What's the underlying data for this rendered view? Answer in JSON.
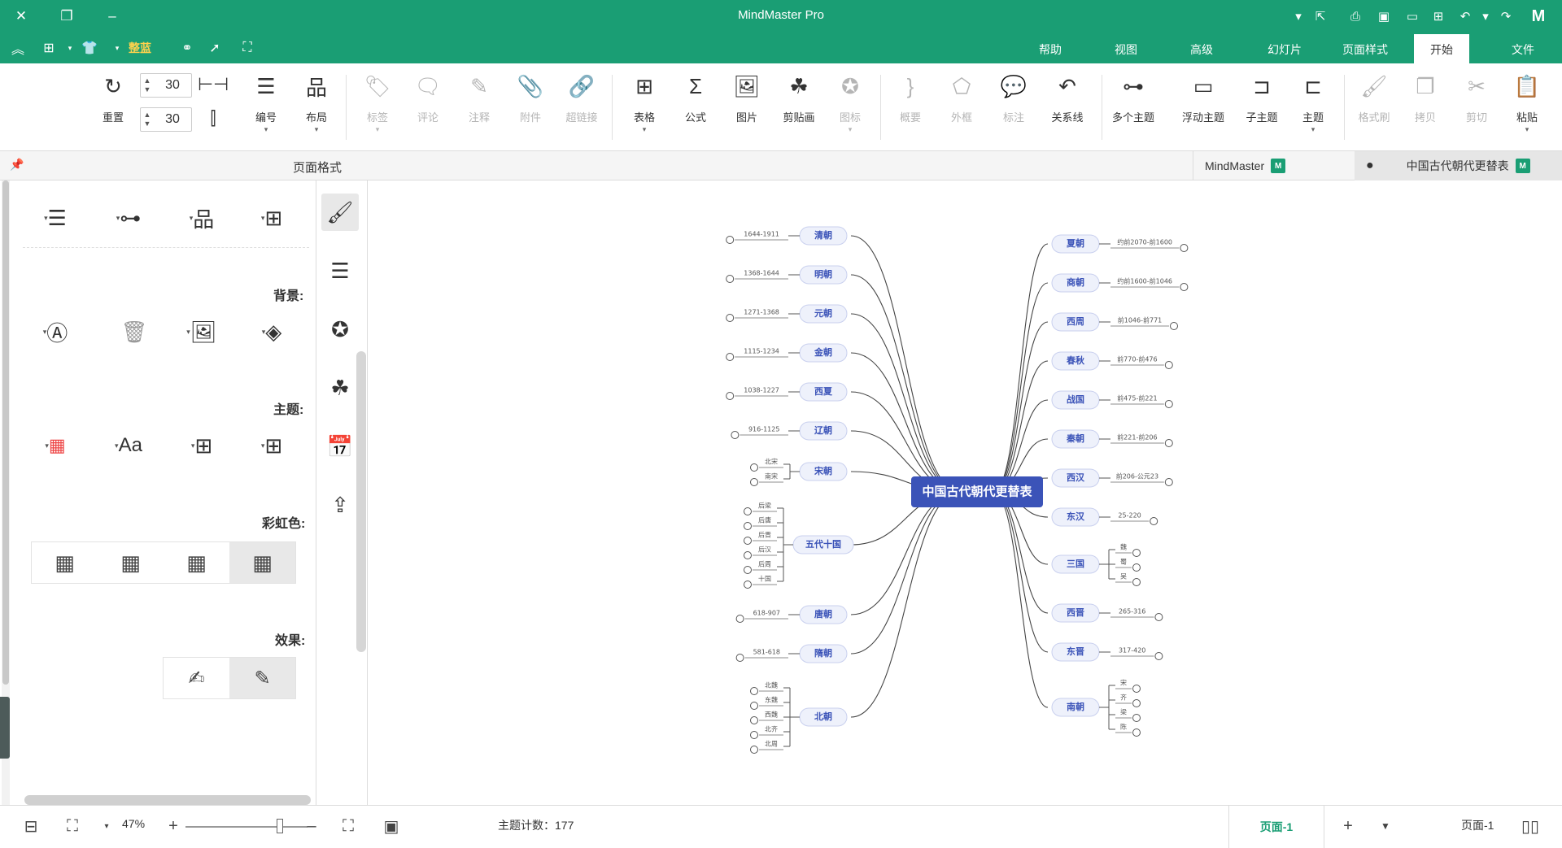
{
  "app": {
    "title": "MindMaster Pro"
  },
  "titlebar_icons": [
    "logo-icon",
    "redo-icon",
    "undo-icon",
    "new-icon",
    "open-icon",
    "save-icon",
    "print-icon",
    "export-icon",
    "more-icon"
  ],
  "menu": {
    "tabs": [
      "文件",
      "开始",
      "页面样式",
      "幻灯片",
      "高级",
      "视图",
      "帮助"
    ],
    "active": "开始",
    "theme_label": "整蓝"
  },
  "ribbon": {
    "buttons": [
      {
        "id": "paste",
        "label": "粘贴",
        "icon": "clipboard-icon",
        "enabled": true,
        "dropdown": true
      },
      {
        "id": "cut",
        "label": "剪切",
        "icon": "scissors-icon",
        "enabled": false
      },
      {
        "id": "copy",
        "label": "拷贝",
        "icon": "copy-icon",
        "enabled": false
      },
      {
        "id": "format-painter",
        "label": "格式刷",
        "icon": "brush-icon",
        "enabled": false
      },
      {
        "id": "topic",
        "label": "主题",
        "icon": "topic-icon",
        "enabled": true,
        "dropdown": true
      },
      {
        "id": "subtopic",
        "label": "子主题",
        "icon": "subtopic-icon",
        "enabled": true
      },
      {
        "id": "floating-topic",
        "label": "浮动主题",
        "icon": "floating-topic-icon",
        "enabled": true
      },
      {
        "id": "multiple-topics",
        "label": "多个主题",
        "icon": "multi-topic-icon",
        "enabled": true
      },
      {
        "id": "relationship",
        "label": "关系线",
        "icon": "relationship-icon",
        "enabled": true
      },
      {
        "id": "callout",
        "label": "标注",
        "icon": "callout-icon",
        "enabled": false
      },
      {
        "id": "boundary",
        "label": "外框",
        "icon": "boundary-icon",
        "enabled": false
      },
      {
        "id": "summary",
        "label": "概要",
        "icon": "summary-icon",
        "enabled": false
      },
      {
        "id": "icon",
        "label": "图标",
        "icon": "star-badge-icon",
        "enabled": false,
        "dropdown": true
      },
      {
        "id": "clipart",
        "label": "剪贴画",
        "icon": "clover-icon",
        "enabled": true
      },
      {
        "id": "picture",
        "label": "图片",
        "icon": "image-icon",
        "enabled": true
      },
      {
        "id": "formula",
        "label": "公式",
        "icon": "sigma-icon",
        "enabled": true
      },
      {
        "id": "table",
        "label": "表格",
        "icon": "table-icon",
        "enabled": true,
        "dropdown": true
      },
      {
        "id": "hyperlink",
        "label": "超链接",
        "icon": "link-icon",
        "enabled": false
      },
      {
        "id": "attachment",
        "label": "附件",
        "icon": "paperclip-icon",
        "enabled": false
      },
      {
        "id": "note",
        "label": "注释",
        "icon": "pencil-icon",
        "enabled": false
      },
      {
        "id": "comment",
        "label": "评论",
        "icon": "comment-icon",
        "enabled": false
      },
      {
        "id": "tag",
        "label": "标签",
        "icon": "tag-icon",
        "enabled": false,
        "dropdown": true
      },
      {
        "id": "layout",
        "label": "布局",
        "icon": "layout-icon",
        "enabled": true,
        "dropdown": true
      },
      {
        "id": "numbering",
        "label": "编号",
        "icon": "numbering-icon",
        "enabled": true,
        "dropdown": true
      },
      {
        "id": "reset",
        "label": "重置",
        "icon": "reset-icon",
        "enabled": true
      }
    ],
    "spacing_h": "30",
    "spacing_v": "30"
  },
  "doc_tabs": [
    {
      "label": "中国古代朝代更替表",
      "active": true,
      "unsaved": true
    },
    {
      "label": "MindMaster",
      "active": false
    }
  ],
  "side_panel": {
    "title": "页面格式",
    "sections": {
      "background": "背景:",
      "theme": "主题:",
      "rainbow": "彩虹色:",
      "effect": "效果:"
    }
  },
  "mindmap": {
    "root": "中国古代朝代更替表",
    "left": [
      {
        "label": "清朝",
        "leaf": "1644-1911"
      },
      {
        "label": "明朝",
        "leaf": "1368-1644"
      },
      {
        "label": "元朝",
        "leaf": "1271-1368"
      },
      {
        "label": "金朝",
        "leaf": "1115-1234"
      },
      {
        "label": "西夏",
        "leaf": "1038-1227"
      },
      {
        "label": "辽朝",
        "leaf": "916-1125"
      },
      {
        "label": "宋朝",
        "children": [
          "北宋",
          "南宋"
        ]
      },
      {
        "label": "五代十国",
        "children": [
          "后梁",
          "后唐",
          "后晋",
          "后汉",
          "后周",
          "十国"
        ]
      },
      {
        "label": "唐朝",
        "leaf": "618-907"
      },
      {
        "label": "隋朝",
        "leaf": "581-618"
      },
      {
        "label": "北朝",
        "children": [
          "北魏",
          "东魏",
          "西魏",
          "北齐",
          "北周"
        ]
      }
    ],
    "right": [
      {
        "label": "夏朝",
        "leaf": "约前2070-前1600"
      },
      {
        "label": "商朝",
        "leaf": "约前1600-前1046"
      },
      {
        "label": "西周",
        "leaf": "前1046-前771"
      },
      {
        "label": "春秋",
        "leaf": "前770-前476"
      },
      {
        "label": "战国",
        "leaf": "前475-前221"
      },
      {
        "label": "秦朝",
        "leaf": "前221-前206"
      },
      {
        "label": "西汉",
        "leaf": "前206-公元23"
      },
      {
        "label": "东汉",
        "leaf": "25-220"
      },
      {
        "label": "三国",
        "children": [
          "魏",
          "蜀",
          "吴"
        ]
      },
      {
        "label": "西晋",
        "leaf": "265-316"
      },
      {
        "label": "东晋",
        "leaf": "317-420"
      },
      {
        "label": "南朝",
        "children": [
          "宋",
          "齐",
          "梁",
          "陈"
        ]
      }
    ]
  },
  "status": {
    "topic_count": "主题计数：177",
    "zoom": "47%",
    "page_active": "页面-1",
    "page_label": "页面-1"
  },
  "colors": {
    "brand": "#1a9e74",
    "root": "#3b53b8",
    "topic_fill": "#eef1fb",
    "topic_text": "#3b53b8"
  }
}
